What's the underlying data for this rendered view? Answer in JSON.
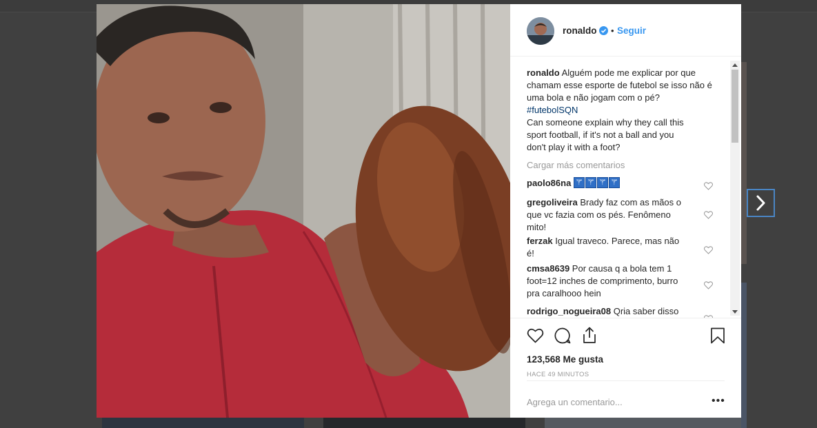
{
  "post": {
    "author": "ronaldo",
    "follow_label": "Seguir",
    "separator": "•",
    "verified_icon": "verified-badge-icon",
    "caption_user": "ronaldo",
    "caption_pt": "Alguém pode me explicar por que chamam esse esporte de futebol se isso não é uma bola e não jogam com o pé?",
    "hashtag": "#futebolSQN",
    "caption_en_1": "Can someone explain why they call this",
    "caption_en_2": "sport football, if it's not a ball and you",
    "caption_en_3": "don't play it with a foot?",
    "load_more": "Cargar más comentarios",
    "likes": "123,568 Me gusta",
    "time": "HACE 49 MINUTOS",
    "add_comment_placeholder": "Agrega un comentario...",
    "more_options": "•••"
  },
  "comments": [
    {
      "user": "paolo86na",
      "text": "",
      "emoji_count": 4,
      "emoji": "TOP"
    },
    {
      "user": "gregoliveira",
      "line1": "Brady faz com as mãos o",
      "line2": "que vc fazia com os pés. Fenômeno",
      "line3": "mito!"
    },
    {
      "user": "ferzak",
      "line1": "Igual traveco. Parece, mas não",
      "line2": "é!"
    },
    {
      "user": "cmsa8639",
      "line1": "Por causa q a bola tem 1",
      "line2": "foot=12 inches de comprimento, burro",
      "line3": "pra caralhooo hein"
    },
    {
      "user": "rodrigo_nogueira08",
      "line1": "Qria saber disso"
    }
  ],
  "colors": {
    "link_blue": "#3897f0",
    "text": "#262626",
    "muted": "#999999",
    "hashtag": "#003569",
    "backdrop": "#404040"
  }
}
